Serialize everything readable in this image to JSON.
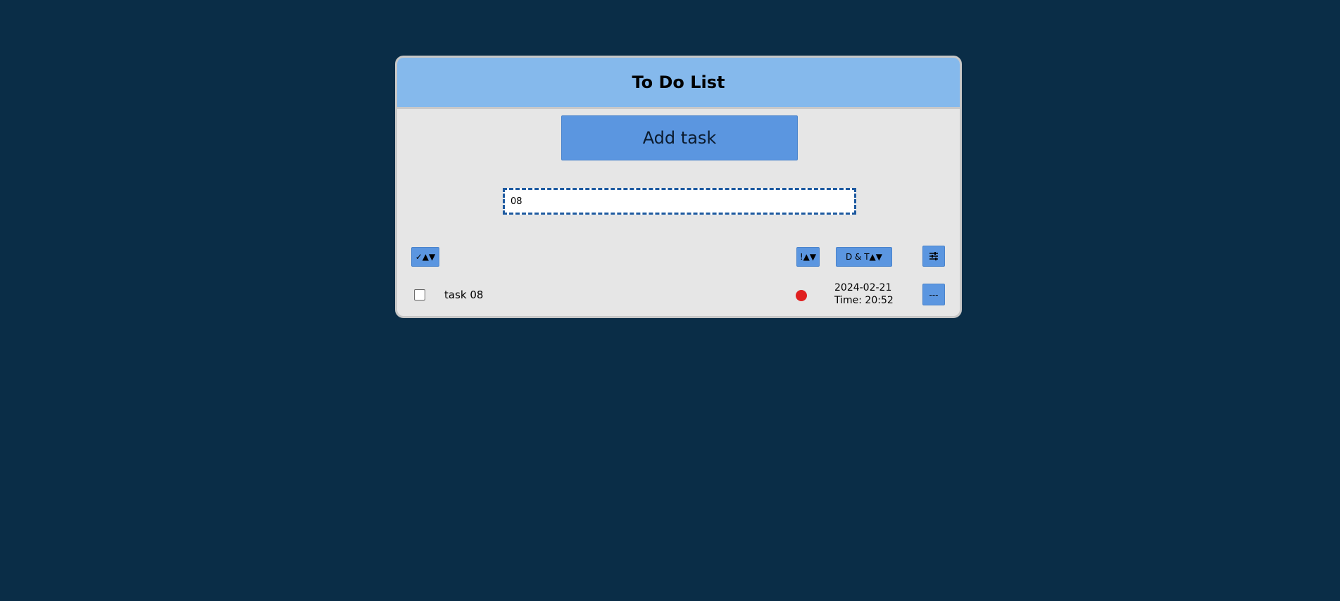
{
  "header": {
    "title": "To Do List"
  },
  "add_task": {
    "label": "Add task"
  },
  "search": {
    "value": "08"
  },
  "sort_bar": {
    "done_label": "✓▲▼",
    "priority_label": "!▲▼",
    "datetime_label": "D & T▲▼"
  },
  "tasks": [
    {
      "name": "task 08",
      "done": false,
      "priority_color": "#e02020",
      "date": "2024-02-21",
      "time": "Time: 20:52",
      "remove_label": "---"
    }
  ],
  "colors": {
    "background": "#0a2d47",
    "header": "#85b9ec",
    "button": "#5b96e0",
    "card": "#e6e6e6"
  },
  "icons": {
    "filter": "sliders-icon"
  }
}
